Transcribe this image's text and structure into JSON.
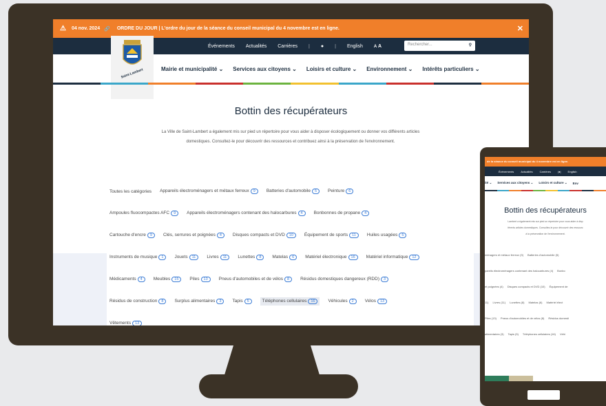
{
  "alert": {
    "date": "04 nov. 2024",
    "message": "ORDRE DU JOUR | L'ordre du jour de la séance du conseil municipal du 4 novembre est en ligne.",
    "close": "✕"
  },
  "topnav": {
    "items": [
      "Événements",
      "Actualités",
      "Carrières"
    ],
    "lang": "English",
    "font_size": "A",
    "font_size_big": "A",
    "search_placeholder": "Rechercher..."
  },
  "logo": {
    "text": "Saint-Lambert"
  },
  "mainnav": [
    "Mairie et municipalité ⌄",
    "Services aux citoyens ⌄",
    "Loisirs et culture ⌄",
    "Environnement ⌄",
    "Intérêts particuliers ⌄"
  ],
  "page": {
    "title": "Bottin des récupérateurs",
    "intro": "La Ville de Saint-Lambert a également mis sur pied un répertoire pour vous aider à disposer écologiquement ou donner vos différents articles domestiques. Consultez-le pour découvrir des ressources et contribuez ainsi à la préservation de l'environnement."
  },
  "categories": [
    [
      {
        "label": "Toutes les catégories"
      },
      {
        "label": "Appareils électroménagers et métaux ferreux",
        "count": "9"
      },
      {
        "label": "Batteries d'automobile",
        "count": "5"
      },
      {
        "label": "Peinture",
        "count": "6"
      }
    ],
    [
      {
        "label": "Ampoules fluocompactes AFC",
        "count": "9"
      },
      {
        "label": "Appareils électroménagers contenant des halocarbures",
        "count": "4"
      },
      {
        "label": "Bonbonnes de propane",
        "count": "4"
      }
    ],
    [
      {
        "label": "Cartouche d'encre",
        "count": "9"
      },
      {
        "label": "Clés, serrures et poignées",
        "count": "4"
      },
      {
        "label": "Disques compacts et DVD",
        "count": "10"
      },
      {
        "label": "Équipement de sports",
        "count": "11"
      },
      {
        "label": "Huiles usagées",
        "count": "5"
      }
    ],
    [
      {
        "label": "Instruments de musique",
        "count": "1"
      },
      {
        "label": "Jouets",
        "count": "11"
      },
      {
        "label": "Livres",
        "count": "11"
      },
      {
        "label": "Lunettes",
        "count": "8"
      },
      {
        "label": "Matelas",
        "count": "6"
      },
      {
        "label": "Matériel électronique",
        "count": "16"
      },
      {
        "label": "Matériel informatique",
        "count": "12"
      }
    ],
    [
      {
        "label": "Médicaments",
        "count": "4"
      },
      {
        "label": "Meubles",
        "count": "15"
      },
      {
        "label": "Piles",
        "count": "13"
      },
      {
        "label": "Pneus d'automobiles et de vélos",
        "count": "8"
      },
      {
        "label": "Résidus domestiques dangereux (RDD)",
        "count": "3"
      }
    ],
    [
      {
        "label": "Résidus de construction",
        "count": "8"
      },
      {
        "label": "Surplus alimentaires",
        "count": "3"
      },
      {
        "label": "Tapis",
        "count": "5"
      },
      {
        "label": "Téléphones cellulaires",
        "count": "16",
        "active": true
      },
      {
        "label": "Véhicules",
        "count": "2"
      },
      {
        "label": "Vélos",
        "count": "13"
      }
    ],
    [
      {
        "label": "Vêtements",
        "count": "13"
      }
    ]
  ],
  "mobile": {
    "alert": "de la séance du conseil municipal du 4 novembre est en ligne.",
    "topnav": [
      "Événements",
      "Actualités",
      "Carrières",
      "English"
    ],
    "mainnav": [
      "ité ⌄",
      "Services aux citoyens ⌄",
      "Loisirs et culture ⌄",
      "Env"
    ],
    "title": "Bottin des récupérateurs",
    "intro": [
      "Lambert a également mis sur pied un répertoire pour vous aider à disp",
      "férents articles domestiques. Consultez-le pour découvrir des ressourc",
      "à la préservation de l'environnement."
    ],
    "rows": [
      [
        "ménagers et métaux ferreux (9)",
        "Batteries d'automobile (5)"
      ],
      [
        "pareils électroménagers contenant des halocarbures (4)",
        "Bonbo"
      ],
      [
        "et poignées (4)",
        "Disques compacts et DVD (10)",
        "Équipement de"
      ],
      [
        "11)",
        "Livres (11)",
        "Lunettes (8)",
        "Matelas (6)",
        "Matériel élect"
      ],
      [
        "Piles (13)",
        "Pneus d'automobiles et de vélos (8)",
        "Résidus domesti"
      ],
      [
        "alimentaires (3)",
        "Tapis (5)",
        "Téléphones cellulaires (16)",
        "Véhi"
      ]
    ]
  },
  "colors": {
    "alert": "#f07f2a",
    "nav": "#1c2d3f",
    "bar": [
      "#1c2d3f",
      "#3aa6c9",
      "#f07f2a",
      "#c9302c",
      "#6cb33f",
      "#f2c12e",
      "#3aa6c9",
      "#c9302c",
      "#1c2d3f",
      "#f07f2a"
    ]
  }
}
